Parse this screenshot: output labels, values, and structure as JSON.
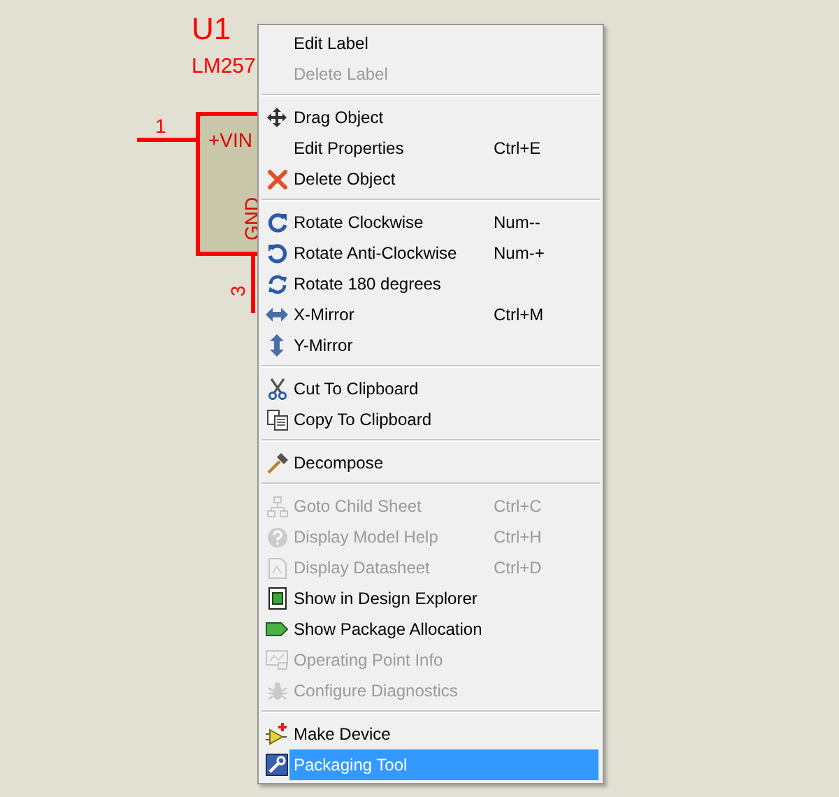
{
  "schematic": {
    "reference": "U1",
    "value": "LM257",
    "pins": [
      {
        "number": "1",
        "name": "+VIN"
      },
      {
        "number": "3",
        "name": "GND"
      }
    ]
  },
  "context_menu": {
    "items": [
      {
        "kind": "item",
        "label": "Edit Label",
        "disabled": false,
        "selected": false
      },
      {
        "kind": "item",
        "label": "Delete Label",
        "disabled": true,
        "selected": false
      },
      {
        "kind": "separator"
      },
      {
        "kind": "item",
        "label": "Drag Object",
        "disabled": false,
        "selected": false
      },
      {
        "kind": "item",
        "label": "Edit Properties",
        "shortcut": "Ctrl+E",
        "disabled": false,
        "selected": false
      },
      {
        "kind": "item",
        "label": "Delete Object",
        "disabled": false,
        "selected": false
      },
      {
        "kind": "separator"
      },
      {
        "kind": "item",
        "label": "Rotate Clockwise",
        "shortcut": "Num--",
        "disabled": false,
        "selected": false
      },
      {
        "kind": "item",
        "label": "Rotate Anti-Clockwise",
        "shortcut": "Num-+",
        "disabled": false,
        "selected": false
      },
      {
        "kind": "item",
        "label": "Rotate 180 degrees",
        "disabled": false,
        "selected": false
      },
      {
        "kind": "item",
        "label": "X-Mirror",
        "shortcut": "Ctrl+M",
        "disabled": false,
        "selected": false
      },
      {
        "kind": "item",
        "label": "Y-Mirror",
        "disabled": false,
        "selected": false
      },
      {
        "kind": "separator"
      },
      {
        "kind": "item",
        "label": "Cut To Clipboard",
        "disabled": false,
        "selected": false
      },
      {
        "kind": "item",
        "label": "Copy To Clipboard",
        "disabled": false,
        "selected": false
      },
      {
        "kind": "separator"
      },
      {
        "kind": "item",
        "label": "Decompose",
        "disabled": false,
        "selected": false
      },
      {
        "kind": "separator"
      },
      {
        "kind": "item",
        "label": "Goto Child Sheet",
        "shortcut": "Ctrl+C",
        "disabled": true,
        "selected": false
      },
      {
        "kind": "item",
        "label": "Display Model Help",
        "shortcut": "Ctrl+H",
        "disabled": true,
        "selected": false
      },
      {
        "kind": "item",
        "label": "Display Datasheet",
        "shortcut": "Ctrl+D",
        "disabled": true,
        "selected": false
      },
      {
        "kind": "item",
        "label": "Show in Design Explorer",
        "disabled": false,
        "selected": false
      },
      {
        "kind": "item",
        "label": "Show Package Allocation",
        "disabled": false,
        "selected": false
      },
      {
        "kind": "item",
        "label": "Operating Point Info",
        "disabled": true,
        "selected": false
      },
      {
        "kind": "item",
        "label": "Configure Diagnostics",
        "disabled": true,
        "selected": false
      },
      {
        "kind": "separator"
      },
      {
        "kind": "item",
        "label": "Make Device",
        "disabled": false,
        "selected": false
      },
      {
        "kind": "item",
        "label": "Packaging Tool",
        "disabled": false,
        "selected": true
      }
    ]
  }
}
